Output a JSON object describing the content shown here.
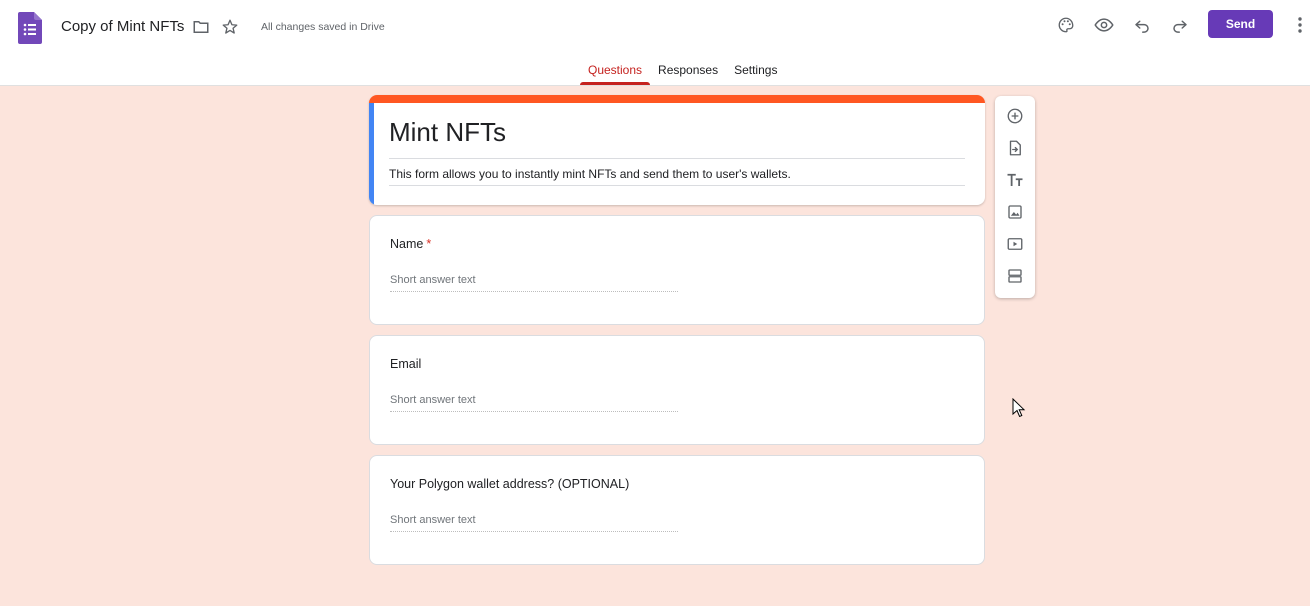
{
  "header": {
    "doc_title": "Copy of Mint NFTs",
    "save_status": "All changes saved in Drive",
    "send_label": "Send",
    "icons": [
      "forms-logo-icon",
      "folder-icon",
      "star-icon",
      "palette-icon",
      "preview-eye-icon",
      "undo-icon",
      "redo-icon",
      "more-vert-icon"
    ]
  },
  "tabs": [
    {
      "label": "Questions",
      "active": true
    },
    {
      "label": "Responses",
      "active": false
    },
    {
      "label": "Settings",
      "active": false
    }
  ],
  "form": {
    "title": "Mint NFTs",
    "description": "This form allows you to instantly mint NFTs and send them to user's wallets.",
    "questions": [
      {
        "title": "Name",
        "required": true,
        "required_mark": "*",
        "placeholder": "Short answer text"
      },
      {
        "title": "Email",
        "required": false,
        "placeholder": "Short answer text"
      },
      {
        "title": "Your Polygon wallet address? (OPTIONAL)",
        "required": false,
        "placeholder": "Short answer text"
      }
    ]
  },
  "toolbar": {
    "tools": [
      "add-question-icon",
      "import-questions-icon",
      "add-title-icon",
      "add-image-icon",
      "add-video-icon",
      "add-section-icon"
    ]
  },
  "colors": {
    "theme_accent": "#ff5722",
    "send_button": "#673ab7",
    "background": "#fce4dc",
    "active_tab": "#c5221f",
    "title_left_bar": "#4285f4"
  }
}
